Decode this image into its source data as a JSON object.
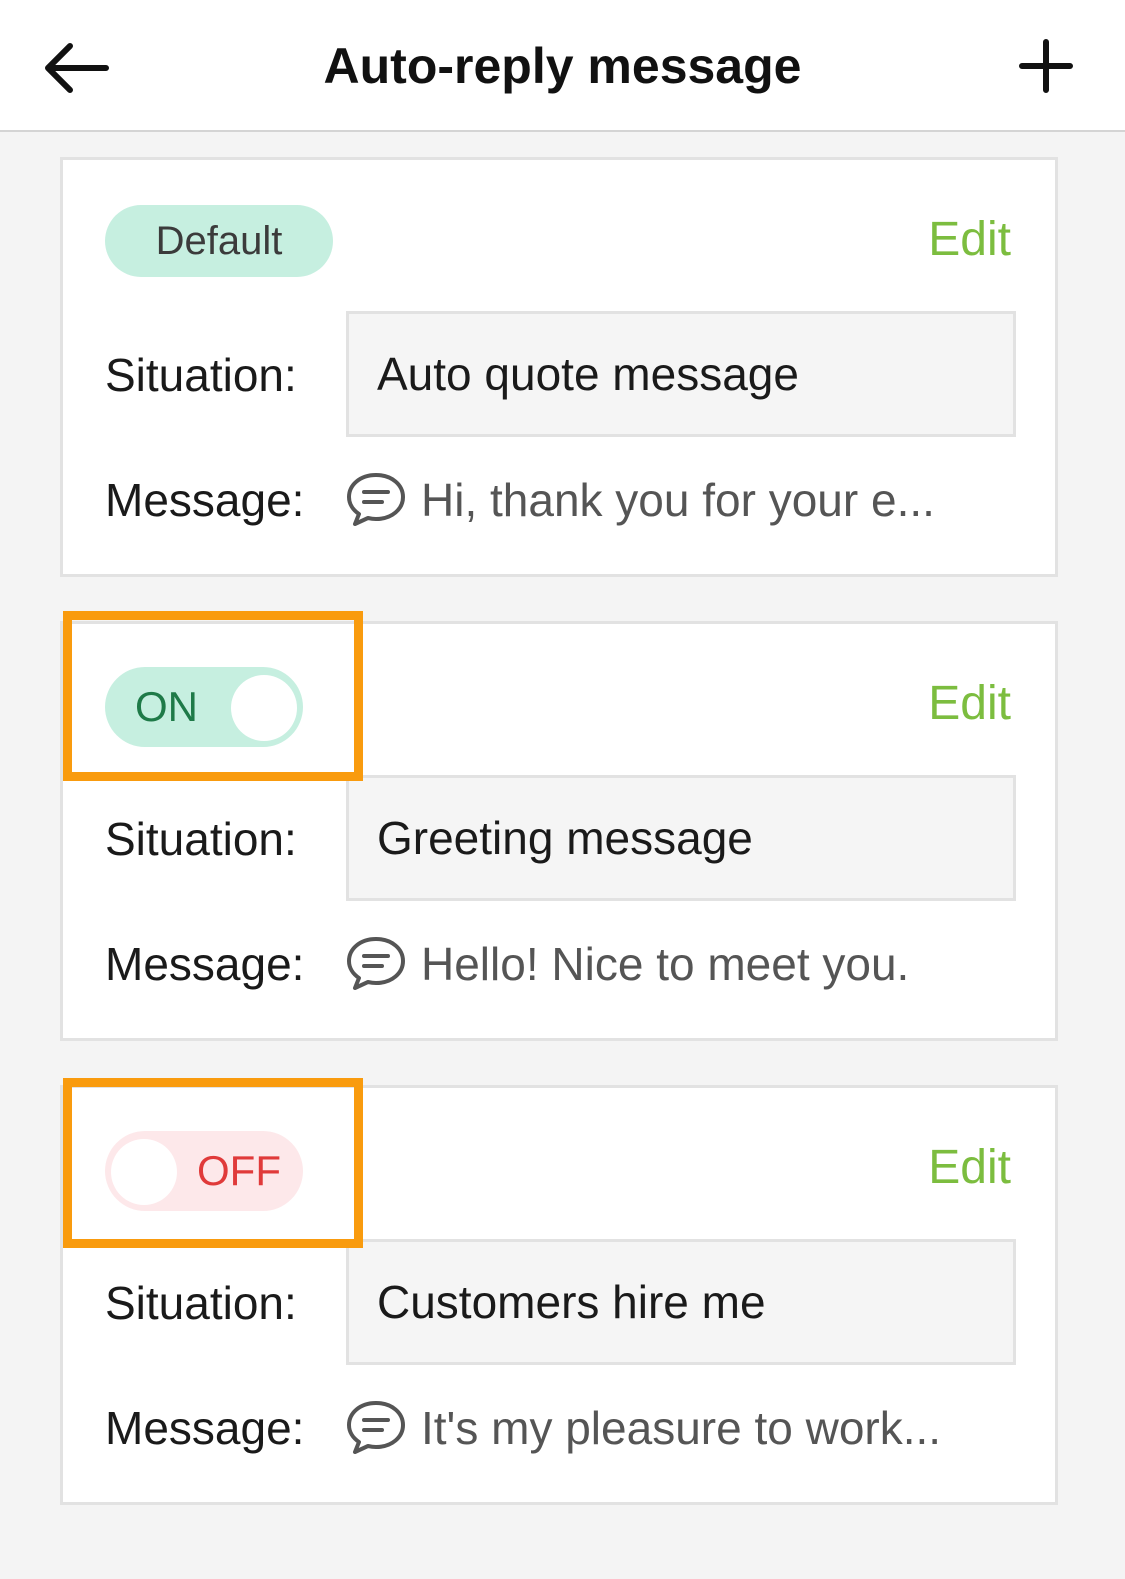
{
  "header": {
    "title": "Auto-reply message",
    "back_icon": "arrow-left-icon",
    "add_icon": "plus-icon"
  },
  "colors": {
    "accent_green": "#7cbd3f",
    "badge_bg": "#c6efe0",
    "on_text": "#1e7a48",
    "off_text": "#e03a3a",
    "off_bg": "#fde8ea",
    "highlight": "#f99b0e"
  },
  "cards": [
    {
      "badge": "Default",
      "edit_label": "Edit",
      "situation_label": "Situation:",
      "situation_value": "Auto quote message",
      "message_label": "Message:",
      "message_icon": "chat-bubble-icon",
      "message_text": "Hi, thank you for your e..."
    },
    {
      "toggle_label": "ON",
      "toggle_state": true,
      "edit_label": "Edit",
      "situation_label": "Situation:",
      "situation_value": "Greeting message",
      "message_label": "Message:",
      "message_icon": "chat-bubble-icon",
      "message_text": "Hello! Nice to meet you."
    },
    {
      "toggle_label": "OFF",
      "toggle_state": false,
      "edit_label": "Edit",
      "situation_label": "Situation:",
      "situation_value": "Customers hire me",
      "message_label": "Message:",
      "message_icon": "chat-bubble-icon",
      "message_text": "It's my pleasure to work..."
    }
  ]
}
